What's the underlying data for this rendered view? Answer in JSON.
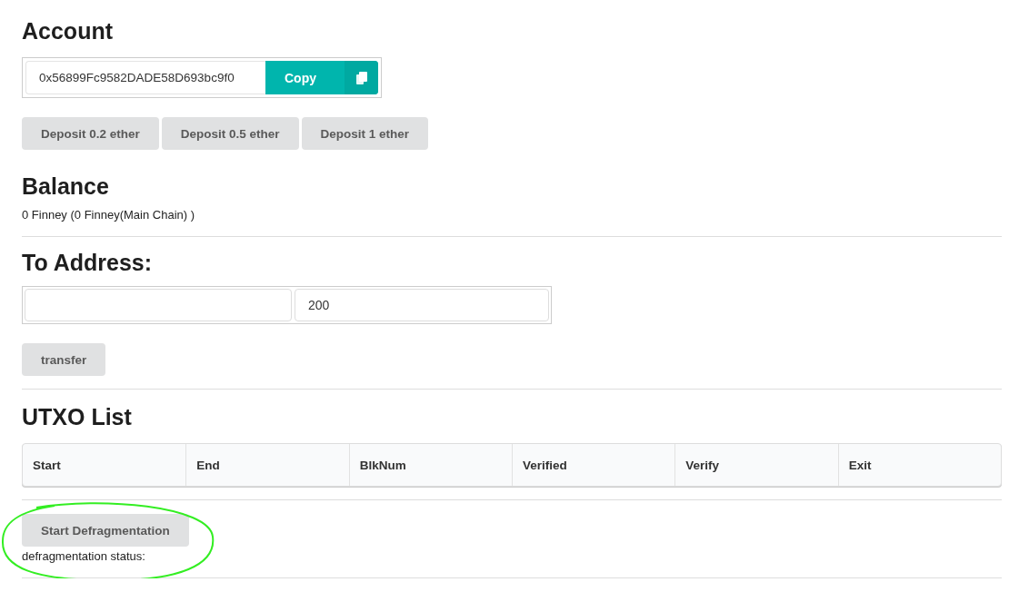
{
  "account": {
    "title": "Account",
    "address": "0x56899Fc9582DADE58D693bc9f0",
    "copy_label": "Copy",
    "deposits": [
      "Deposit 0.2 ether",
      "Deposit 0.5 ether",
      "Deposit 1 ether"
    ]
  },
  "balance": {
    "title": "Balance",
    "text": "0 Finney (0 Finney(Main Chain) )"
  },
  "transfer": {
    "title": "To Address:",
    "amount_value": "200",
    "button": "transfer"
  },
  "utxo": {
    "title": "UTXO List",
    "columns": [
      "Start",
      "End",
      "BlkNum",
      "Verified",
      "Verify",
      "Exit"
    ]
  },
  "defragmentation": {
    "button": "Start Defragmentation",
    "status_label": "defragmentation status:",
    "highlight": {
      "color": "#33ee22"
    }
  }
}
